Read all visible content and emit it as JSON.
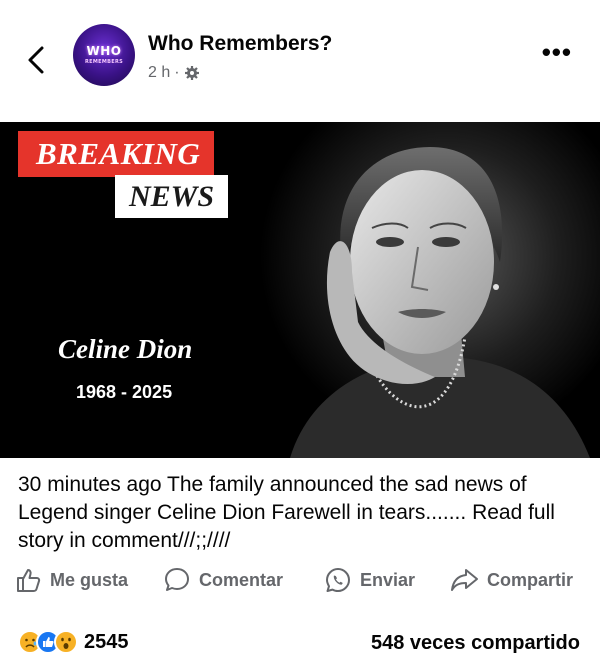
{
  "post": {
    "page_name": "Who Remembers?",
    "time": "2 h",
    "separator": "·",
    "avatar_text_top": "WHO",
    "avatar_text_bottom": "REMEMBERS",
    "more_label": "•••",
    "text": "30 minutes ago  The family announced the sad news of Legend singer Celine Dion  Farewell in tears....... Read full story in comment///;;////"
  },
  "media": {
    "breaking": "BREAKING",
    "news": "NEWS",
    "name": "Celine Dion",
    "years": "1968 - 2025",
    "colors": {
      "banner_red": "#e5342b",
      "background": "#000000"
    }
  },
  "actions": {
    "like": "Me gusta",
    "comment": "Comentar",
    "send": "Enviar",
    "share": "Compartir"
  },
  "footer": {
    "reaction_count": "2545",
    "shares": "548 veces compartido",
    "reaction_icons": [
      "sad-icon",
      "like-icon",
      "wow-icon"
    ]
  },
  "colors": {
    "muted_text": "#65676b",
    "primary_text": "#050505",
    "like_blue": "#1877f2"
  }
}
